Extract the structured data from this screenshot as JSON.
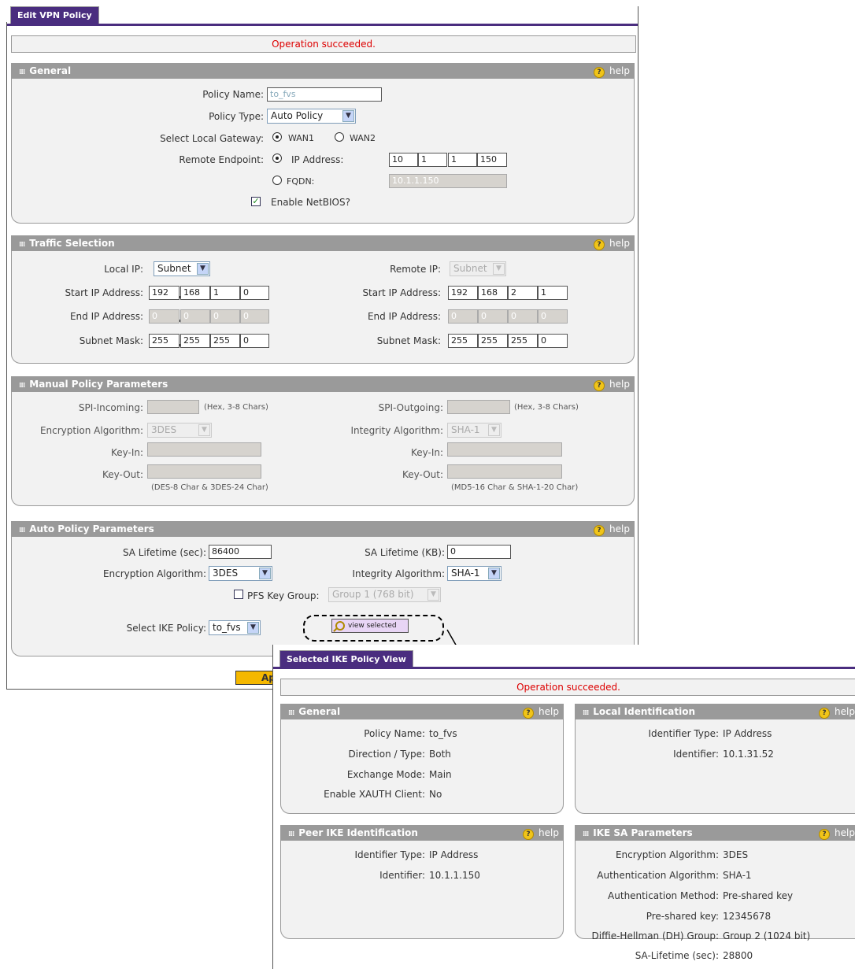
{
  "edit": {
    "tab_title": "Edit VPN Policy",
    "status": "Operation succeeded.",
    "help": "help",
    "general": {
      "title": "General",
      "policy_name_label": "Policy Name:",
      "policy_name": "to_fvs",
      "policy_type_label": "Policy Type:",
      "policy_type": "Auto Policy",
      "local_gateway_label": "Select Local Gateway:",
      "wan1": "WAN1",
      "wan2": "WAN2",
      "remote_endpoint_label": "Remote Endpoint:",
      "ip_address_option": "IP Address:",
      "ip": [
        "10",
        "1",
        "1",
        "150"
      ],
      "fqdn_option": "FQDN:",
      "fqdn": "10.1.1.150",
      "netbios": "Enable NetBIOS?"
    },
    "traffic": {
      "title": "Traffic Selection",
      "local_ip_label": "Local IP:",
      "local_ip": "Subnet",
      "remote_ip_label": "Remote IP:",
      "remote_ip": "Subnet",
      "start_label": "Start IP Address:",
      "end_label": "End IP Address:",
      "mask_label": "Subnet Mask:",
      "local_start": [
        "192",
        "168",
        "1",
        "0"
      ],
      "local_end": [
        "0",
        "0",
        "0",
        "0"
      ],
      "local_mask": [
        "255",
        "255",
        "255",
        "0"
      ],
      "remote_start": [
        "192",
        "168",
        "2",
        "1"
      ],
      "remote_end": [
        "0",
        "0",
        "0",
        "0"
      ],
      "remote_mask": [
        "255",
        "255",
        "255",
        "0"
      ]
    },
    "manual": {
      "title": "Manual Policy Parameters",
      "spi_in_label": "SPI-Incoming:",
      "spi_out_label": "SPI-Outgoing:",
      "hex_hint": "(Hex, 3-8 Chars)",
      "enc_label": "Encryption Algorithm:",
      "enc": "3DES",
      "int_label": "Integrity Algorithm:",
      "int": "SHA-1",
      "key_in_label": "Key-In:",
      "key_out_label": "Key-Out:",
      "enc_key_hint": "(DES-8 Char & 3DES-24 Char)",
      "int_key_hint": "(MD5-16 Char & SHA-1-20 Char)"
    },
    "auto": {
      "title": "Auto Policy Parameters",
      "sa_sec_label": "SA Lifetime (sec):",
      "sa_sec": "86400",
      "sa_kb_label": "SA Lifetime (KB):",
      "sa_kb": "0",
      "enc_label": "Encryption Algorithm:",
      "enc": "3DES",
      "int_label": "Integrity Algorithm:",
      "int": "SHA-1",
      "pfs_label": "PFS Key Group:",
      "pfs": "Group 1 (768 bit)",
      "ike_label": "Select IKE Policy:",
      "ike": "to_fvs",
      "view_selected": "view selected"
    },
    "apply": "Ap"
  },
  "ike_view": {
    "tab_title": "Selected IKE Policy View",
    "status": "Operation succeeded.",
    "help": "help",
    "general": {
      "title": "General",
      "rows": [
        {
          "label": "Policy Name:",
          "value": "to_fvs"
        },
        {
          "label": "Direction / Type:",
          "value": "Both"
        },
        {
          "label": "Exchange Mode:",
          "value": "Main"
        },
        {
          "label": "Enable XAUTH Client:",
          "value": "No"
        }
      ]
    },
    "local": {
      "title": "Local Identification",
      "rows": [
        {
          "label": "Identifier Type:",
          "value": "IP Address"
        },
        {
          "label": "Identifier:",
          "value": "10.1.31.52"
        }
      ]
    },
    "peer": {
      "title": "Peer IKE Identification",
      "rows": [
        {
          "label": "Identifier Type:",
          "value": "IP Address"
        },
        {
          "label": "Identifier:",
          "value": "10.1.1.150"
        }
      ]
    },
    "sa": {
      "title": "IKE SA Parameters",
      "rows": [
        {
          "label": "Encryption Algorithm:",
          "value": "3DES"
        },
        {
          "label": "Authentication Algorithm:",
          "value": "SHA-1"
        },
        {
          "label": "Authentication Method:",
          "value": "Pre-shared key"
        },
        {
          "label": "Pre-shared key:",
          "value": "12345678"
        },
        {
          "label": "Diffie-Hellman (DH) Group:",
          "value": "Group 2 (1024 bit)"
        },
        {
          "label": "SA-Lifetime (sec):",
          "value": "28800"
        }
      ]
    }
  }
}
